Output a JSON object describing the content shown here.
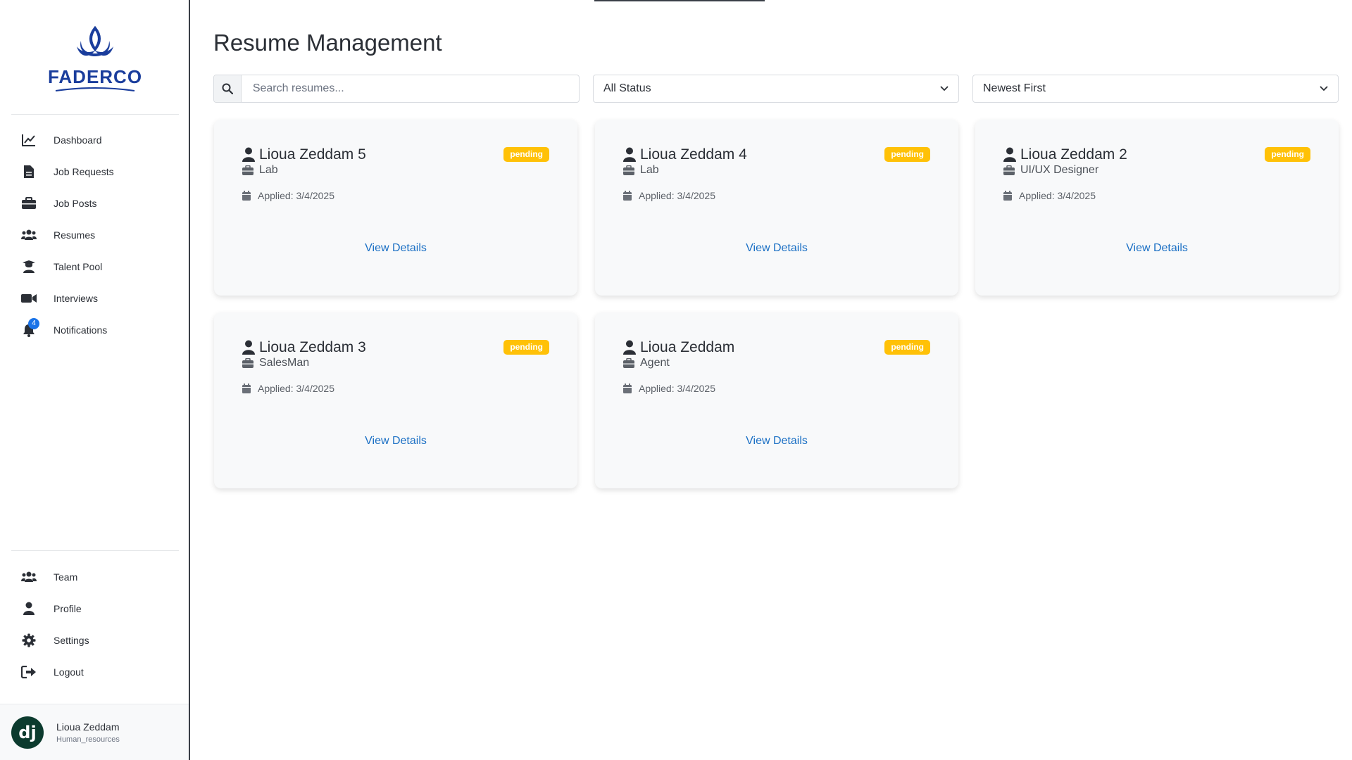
{
  "brand": {
    "name": "FADERCO",
    "color": "#1a3d9c"
  },
  "nav": [
    {
      "label": "Dashboard",
      "icon": "chart-line-icon"
    },
    {
      "label": "Job Requests",
      "icon": "file-icon"
    },
    {
      "label": "Job Posts",
      "icon": "briefcase-icon"
    },
    {
      "label": "Resumes",
      "icon": "users-icon"
    },
    {
      "label": "Talent Pool",
      "icon": "graduate-icon"
    },
    {
      "label": "Interviews",
      "icon": "video-icon"
    },
    {
      "label": "Notifications",
      "icon": "bell-icon",
      "badge": "4"
    }
  ],
  "nav_bottom": [
    {
      "label": "Team",
      "icon": "users-icon"
    },
    {
      "label": "Profile",
      "icon": "user-icon"
    },
    {
      "label": "Settings",
      "icon": "gear-icon"
    },
    {
      "label": "Logout",
      "icon": "logout-icon"
    }
  ],
  "user": {
    "avatar_text": "dj",
    "name": "Lioua Zeddam",
    "role": "Human_resources"
  },
  "page": {
    "title": "Resume Management"
  },
  "search": {
    "placeholder": "Search resumes..."
  },
  "filters": {
    "status": "All Status",
    "sort": "Newest First"
  },
  "cards": [
    {
      "name": "Lioua Zeddam 5",
      "position": "Lab",
      "applied": "Applied: 3/4/2025",
      "status": "pending",
      "link": "View Details"
    },
    {
      "name": "Lioua Zeddam 4",
      "position": "Lab",
      "applied": "Applied: 3/4/2025",
      "status": "pending",
      "link": "View Details"
    },
    {
      "name": "Lioua Zeddam 2",
      "position": "UI/UX Designer",
      "applied": "Applied: 3/4/2025",
      "status": "pending",
      "link": "View Details"
    },
    {
      "name": "Lioua Zeddam 3",
      "position": "SalesMan",
      "applied": "Applied: 3/4/2025",
      "status": "pending",
      "link": "View Details"
    },
    {
      "name": "Lioua Zeddam",
      "position": "Agent",
      "applied": "Applied: 3/4/2025",
      "status": "pending",
      "link": "View Details"
    }
  ],
  "colors": {
    "pending": "#ffc107",
    "link": "#1a6fc4",
    "badge": "#1a73e8"
  }
}
